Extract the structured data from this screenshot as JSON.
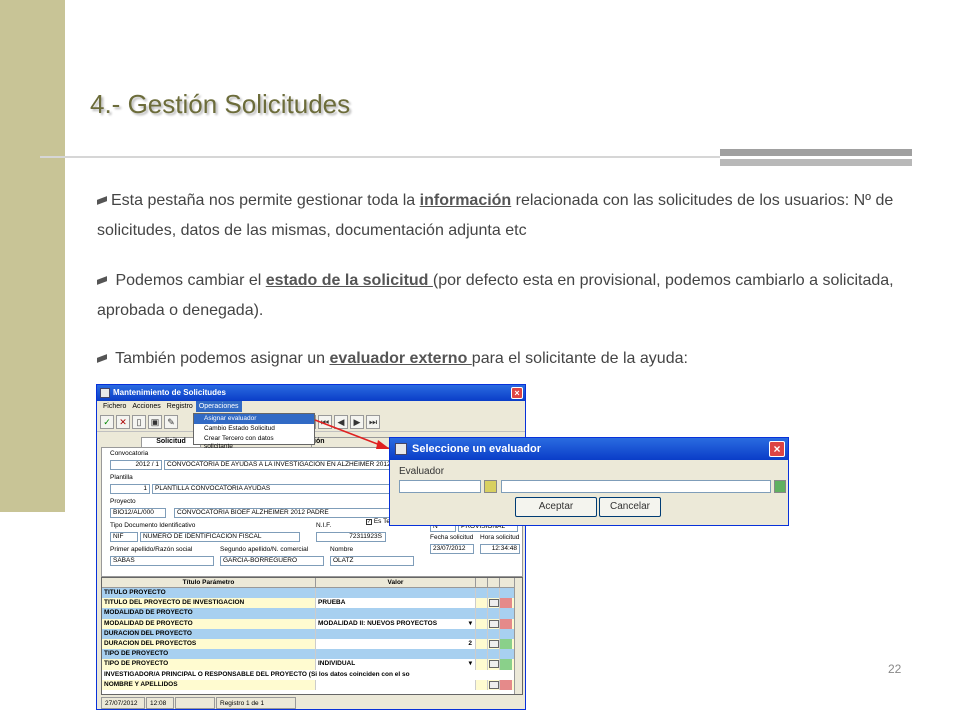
{
  "slide": {
    "title": "4.- Gestión Solicitudes",
    "page_number": "22"
  },
  "paragraphs": {
    "p1_a": "Esta pestaña nos permite gestionar toda la ",
    "p1_link": "información",
    "p1_b": " relacionada con las solicitudes de los usuarios: Nº de solicitudes, datos  de las mismas, documentación adjunta etc",
    "p2_a": " Podemos cambiar el ",
    "p2_link": "estado de la solicitud ",
    "p2_b": "(por defecto esta en provisional, podemos cambiarlo a solicitada, aprobada o denegada).",
    "p3_a": " También podemos asignar un ",
    "p3_link": "evaluador externo ",
    "p3_b": "para el solicitante de la ayuda:"
  },
  "main_window": {
    "title": "Mantenimiento de Solicitudes",
    "menu": [
      "Fichero",
      "Acciones",
      "Registro",
      "Operaciones"
    ],
    "dropdown": [
      "Asignar evaluador",
      "Cambio Estado Solicitud",
      "Crear Tercero con datos solicitante"
    ],
    "tab_active": "Solicitud",
    "tab_other": "ión",
    "fields": {
      "convocatoria_label": "Convocatoria",
      "convocatoria_code": "2012 / 1",
      "convocatoria_desc": "CONVOCATORIA DE AYUDAS A LA INVESTIGACIÓN EN ALZHEIMER 2012",
      "plantilla_label": "Plantilla",
      "plantilla_code": "1",
      "plantilla_desc": "PLANTILLA CONVOCATORIA AYUDAS",
      "proyecto_label": "Proyecto",
      "proyecto_code": "BIO12/AL/000",
      "proyecto_desc": "CONVOCATORIA BIOEF ALZHEIMER 2012 PADRE",
      "tipo_doc_label": "Tipo Documento Identificativo",
      "tipo_doc_code": "NIF",
      "tipo_doc_desc": "NUMERO DE IDENTIFICACION FISCAL",
      "nif_label": "N.I.F.",
      "nif_value": "72311923S",
      "es_tercero_label": "Es Tercero",
      "estado_code": "N",
      "estado_desc": "PROVISIONAL",
      "fecha_label": "Fecha solicitud",
      "fecha_value": "23/07/2012",
      "hora_label": "Hora solicitud",
      "hora_value": "12:34:48",
      "apellido1_label": "Primer apellido/Razón social",
      "apellido1_value": "SABAS",
      "apellido2_label": "Segundo apellido/N. comercial",
      "apellido2_value": "GARCIA-BORREGUERO",
      "nombre_label": "Nombre",
      "nombre_value": "OLATZ"
    },
    "grid_headers": [
      "Título Parámetro",
      "Valor"
    ],
    "grid_rows": [
      {
        "type": "sec",
        "c1": "TITULO PROYECTO",
        "c2": ""
      },
      {
        "type": "val",
        "c1": "TITULO DEL PROYECTO DE INVESTIGACION",
        "c2": "PRUEBA",
        "c2r": ""
      },
      {
        "type": "sec",
        "c1": "MODALIDAD DE PROYECTO",
        "c2": ""
      },
      {
        "type": "val",
        "c1": "MODALIDAD DE PROYECTO",
        "c2": "MODALIDAD II: NUEVOS PROYECTOS",
        "c2r": "▾"
      },
      {
        "type": "sec",
        "c1": "DURACION DEL PROYECTO",
        "c2": ""
      },
      {
        "type": "val",
        "c1": "DURACION DEL PROYECTOS",
        "c2": "",
        "c2r": "2"
      },
      {
        "type": "sec",
        "c1": "TIPO DE PROYECTO",
        "c2": ""
      },
      {
        "type": "val",
        "c1": "TIPO DE PROYECTO",
        "c2": "INDIVIDUAL",
        "c2r": "▾"
      },
      {
        "type": "full",
        "c1": "INVESTIGADOR/A PRINCIPAL O RESPONSABLE DEL PROYECTO (Si los datos coinciden con el so",
        "c2": ""
      },
      {
        "type": "val",
        "c1": "NOMBRE Y APELLIDOS",
        "c2": "",
        "c2r": ""
      }
    ],
    "status": {
      "date": "27/07/2012",
      "time": "12:08",
      "record": "Registro 1 de 1"
    }
  },
  "dialog": {
    "title": "Seleccione un evaluador",
    "label": "Evaluador",
    "accept": "Aceptar",
    "cancel": "Cancelar"
  }
}
